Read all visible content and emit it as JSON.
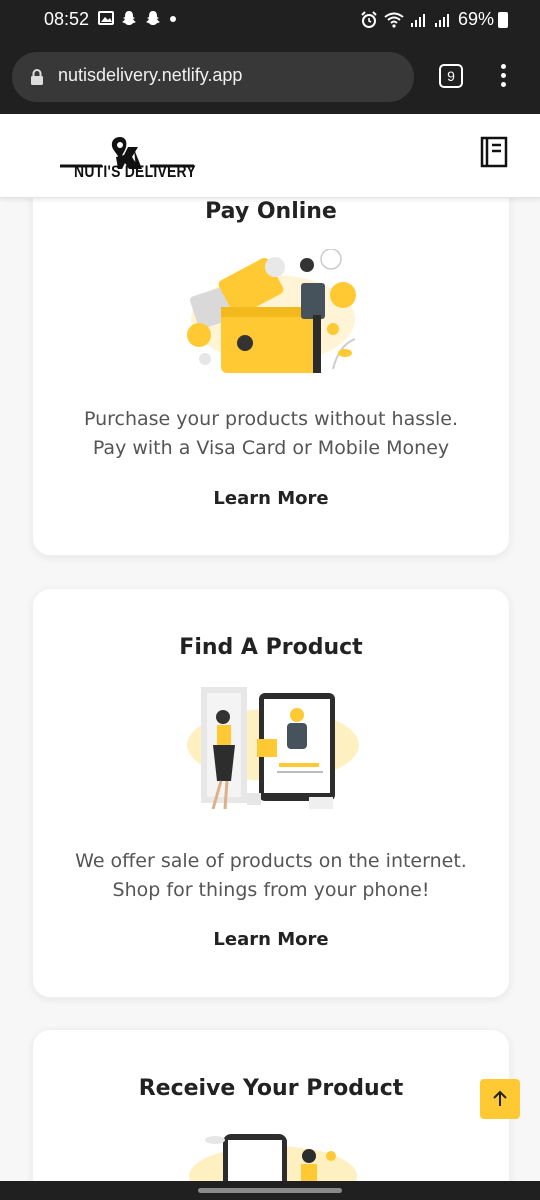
{
  "status_bar": {
    "time": "08:52",
    "battery_percent": "69%",
    "left_icons": [
      "gallery-icon",
      "snapchat-icon",
      "snapchat-icon",
      "dot-icon"
    ],
    "right_icons": [
      "alarm-icon",
      "wifi-icon",
      "signal-icon",
      "signal-icon",
      "battery-icon"
    ]
  },
  "browser": {
    "url": "nutisdelivery.netlify.app",
    "tab_count": "9"
  },
  "header": {
    "brand_name": "NUTI'S DELIVERY"
  },
  "cards": [
    {
      "title": "Pay Online",
      "description_line1": "Purchase your products without hassle.",
      "description_line2": "Pay with a Visa Card or Mobile Money",
      "link": "Learn More"
    },
    {
      "title": "Find A Product",
      "description_line1": "We offer sale of products on the internet.",
      "description_line2": "Shop for things from your phone!",
      "link": "Learn More"
    },
    {
      "title": "Receive Your Product"
    }
  ],
  "colors": {
    "accent": "#ffc933",
    "dark_bar": "#202020",
    "text": "#222222"
  }
}
